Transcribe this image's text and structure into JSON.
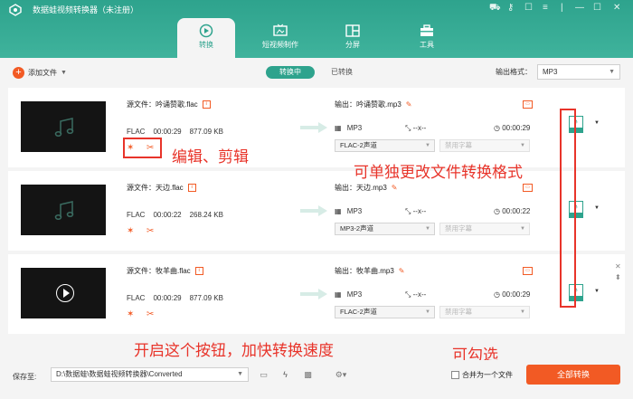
{
  "app": {
    "title": "数据蛙视频转换器（未注册）"
  },
  "tabs": [
    {
      "label": "转换",
      "icon": "convert-icon"
    },
    {
      "label": "短视频制作",
      "icon": "tv-icon"
    },
    {
      "label": "分屏",
      "icon": "split-screen-icon"
    },
    {
      "label": "工具",
      "icon": "toolbox-icon"
    }
  ],
  "toolbar": {
    "add_file": "添加文件",
    "status_active": "转换中",
    "status_other": "已转换",
    "output_format_label": "输出格式：",
    "output_format_value": "MP3"
  },
  "files": [
    {
      "source": "源文件：吟诵赞歌.flac",
      "format": "FLAC",
      "duration": "00:00:29",
      "size": "877.09 KB",
      "output": "输出：吟诵赞歌.mp3",
      "out_format": "MP3",
      "resolution": "--x--",
      "out_duration": "00:00:29",
      "audio": "FLAC-2声道",
      "subtitle": "禁用字幕"
    },
    {
      "source": "源文件：天边.flac",
      "format": "FLAC",
      "duration": "00:00:22",
      "size": "268.24 KB",
      "output": "输出：天边.mp3",
      "out_format": "MP3",
      "resolution": "--x--",
      "out_duration": "00:00:22",
      "audio": "MP3-2声道",
      "subtitle": "禁用字幕"
    },
    {
      "source": "源文件：牧羊曲.flac",
      "format": "FLAC",
      "duration": "00:00:29",
      "size": "877.09 KB",
      "output": "输出：牧羊曲.mp3",
      "out_format": "MP3",
      "resolution": "--x--",
      "out_duration": "00:00:29",
      "audio": "FLAC-2声道",
      "subtitle": "禁用字幕"
    }
  ],
  "annotations": {
    "edit_cut": "编辑、剪辑",
    "change_format": "可单独更改文件转换格式",
    "speed_up": "开启这个按钮，加快转换速度",
    "can_check": "可勾选"
  },
  "bottom": {
    "save_label": "保存至:",
    "save_path": "D:\\数据蛙\\数据蛙视频转换器\\Converted",
    "merge_label": "合并为一个文件",
    "convert_all": "全部转换"
  },
  "colors": {
    "brand": "#2ea38d",
    "accent": "#f25a24",
    "annotation": "#e8342a"
  }
}
